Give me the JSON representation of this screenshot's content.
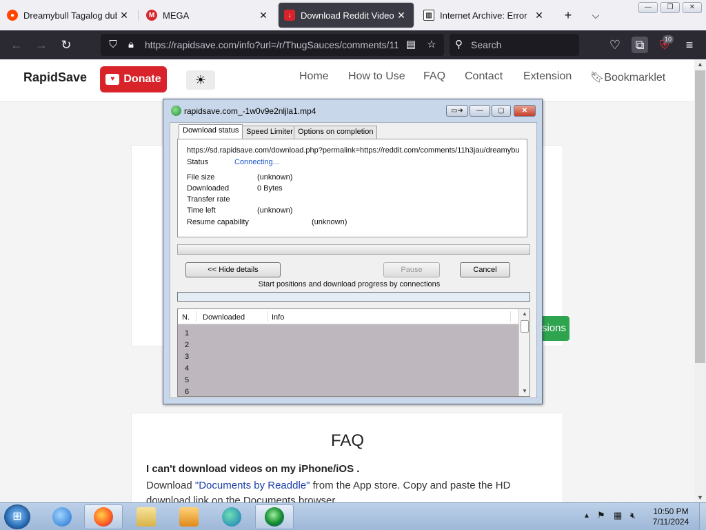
{
  "browser": {
    "tabs": [
      {
        "title": "Dreamybull Tagalog dub :",
        "favicon": "reddit-favicon",
        "color": "#ff4500"
      },
      {
        "title": "MEGA",
        "favicon": "mega-favicon",
        "color": "#d9272e"
      },
      {
        "title": "Download Reddit Videos w",
        "favicon": "rapidsave-favicon",
        "color": "#d8232a"
      },
      {
        "title": "Internet Archive: Error",
        "favicon": "archive-favicon",
        "color": "#333333"
      }
    ],
    "new_tab_symbol": "+",
    "list_tabs_symbol": "⌵",
    "url": "https://rapidsave.com/info?url=/r/ThugSauces/comments/11",
    "search_placeholder": "Search",
    "extension_badge": "10"
  },
  "site": {
    "brand": "RapidSave",
    "donate_label": "Donate",
    "nav": [
      "Home",
      "How to Use",
      "FAQ",
      "Contact",
      "Extension",
      "Bookmarklet"
    ],
    "green_button_label": "sions",
    "faq": {
      "title": "FAQ",
      "question": "I can't download videos on my iPhone/iOS .",
      "answer_prefix": "Download ",
      "answer_link": "\"Documents by Readdle\"",
      "answer_suffix": " from the App store. Copy and paste the HD download link on the Documents browser."
    }
  },
  "dialog": {
    "title": "rapidsave.com_-1w0v9e2nljla1.mp4",
    "tabs": [
      "Download status",
      "Speed Limiter",
      "Options on completion"
    ],
    "url_line": "https://sd.rapidsave.com/download.php?permalink=https://reddit.com/comments/11h3jau/dreamybu",
    "status_label": "Status",
    "status_value": "Connecting...",
    "rows": [
      {
        "label": "File size",
        "value": "(unknown)"
      },
      {
        "label": "Downloaded",
        "value": "0 Bytes"
      },
      {
        "label": "Transfer rate",
        "value": ""
      },
      {
        "label": "Time left",
        "value": "(unknown)"
      }
    ],
    "resume_label": "Resume capability",
    "resume_value": "(unknown)",
    "hide_details_label": "<< Hide details",
    "pause_label": "Pause",
    "cancel_label": "Cancel",
    "connections_label": "Start positions and download progress by connections",
    "columns": [
      "N.",
      "Downloaded",
      "Info"
    ],
    "connection_rows": [
      "1",
      "2",
      "3",
      "4",
      "5",
      "6"
    ]
  },
  "taskbar": {
    "clock_time": "10:50 PM",
    "clock_date": "7/11/2024",
    "apps": [
      "internet-explorer-icon",
      "firefox-icon",
      "file-explorer-icon",
      "media-player-icon",
      "edge-icon",
      "idm-icon"
    ]
  }
}
